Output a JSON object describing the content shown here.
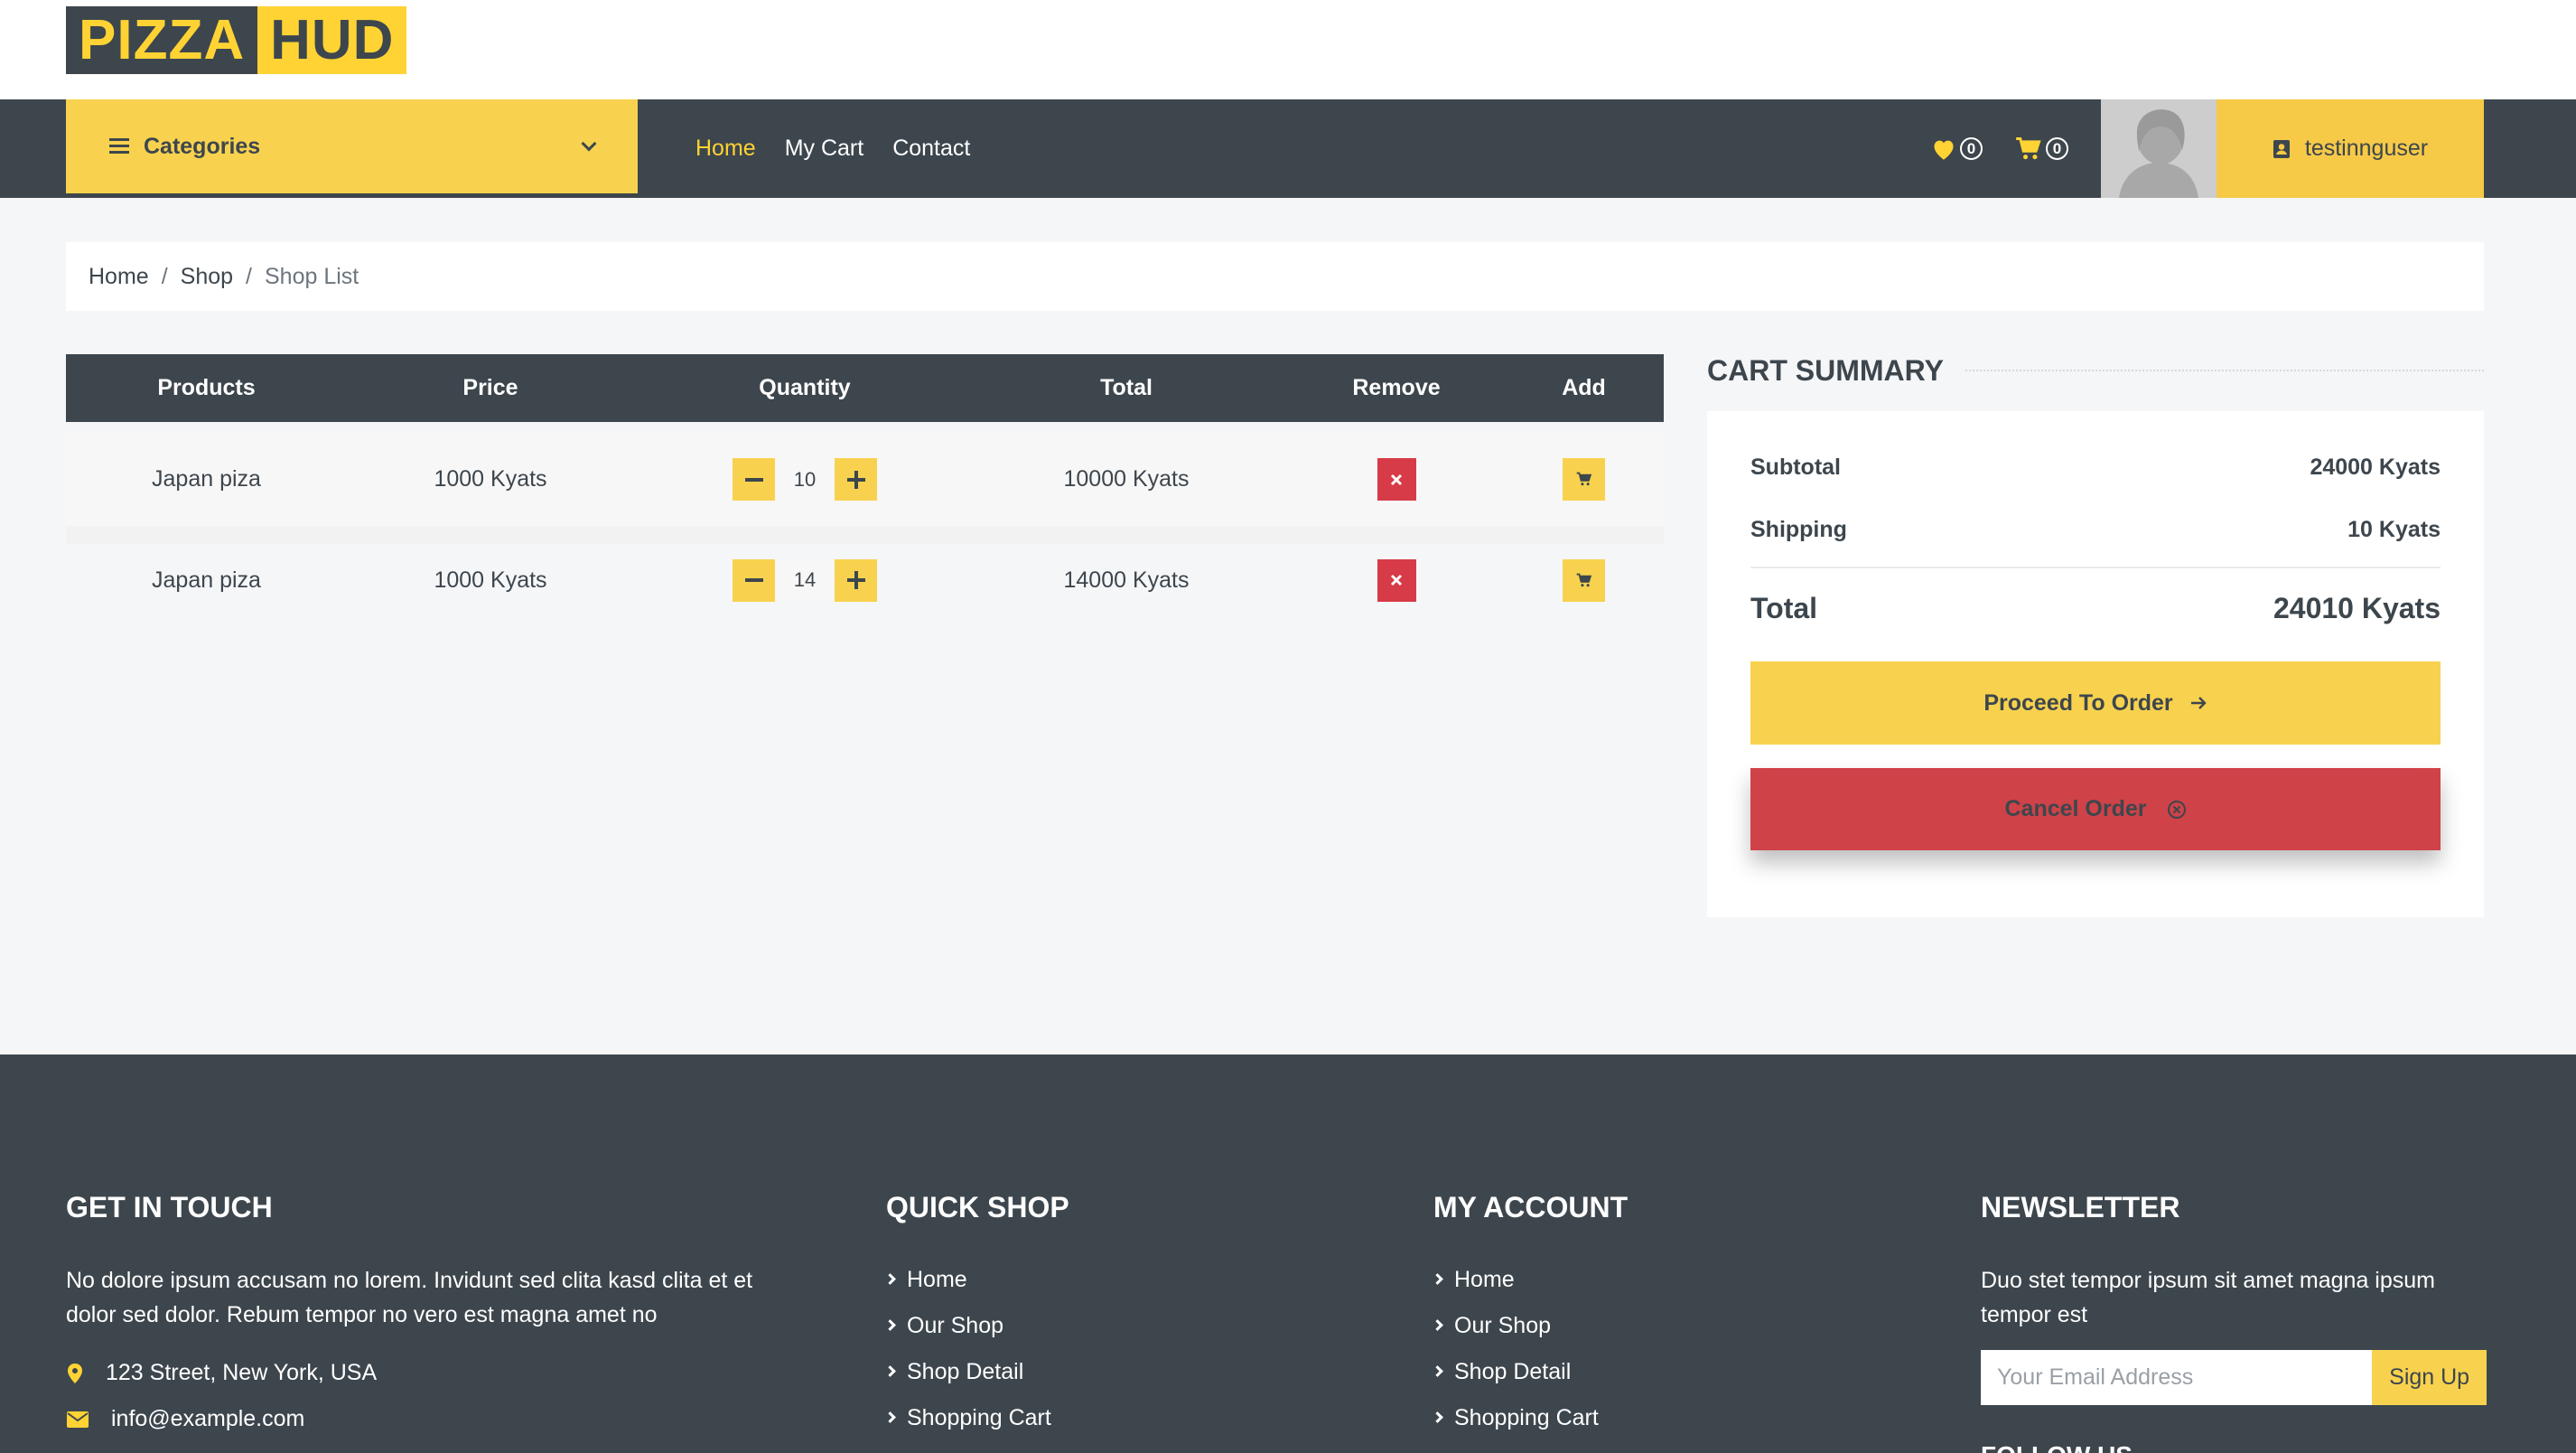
{
  "brand": {
    "part1": "PIZZA",
    "part2": "HUD"
  },
  "nav": {
    "categories_label": "Categories",
    "links": [
      {
        "label": "Home",
        "active": true
      },
      {
        "label": "My Cart",
        "active": false
      },
      {
        "label": "Contact",
        "active": false
      }
    ],
    "wishlist_count": "0",
    "cart_count": "0",
    "username": "testinnguser"
  },
  "breadcrumb": {
    "items": [
      "Home",
      "Shop",
      "Shop List"
    ],
    "separator": "/"
  },
  "cart": {
    "headers": [
      "Products",
      "Price",
      "Quantity",
      "Total",
      "Remove",
      "Add"
    ],
    "rows": [
      {
        "product": "Japan piza",
        "price": "1000 Kyats",
        "quantity": "10",
        "total": "10000 Kyats"
      },
      {
        "product": "Japan piza",
        "price": "1000 Kyats",
        "quantity": "14",
        "total": "14000 Kyats"
      }
    ]
  },
  "summary": {
    "title": "CART SUMMARY",
    "subtotal_label": "Subtotal",
    "subtotal_value": "24000 Kyats",
    "shipping_label": "Shipping",
    "shipping_value": "10 Kyats",
    "total_label": "Total",
    "total_value": "24010 Kyats",
    "proceed_label": "Proceed To Order",
    "cancel_label": "Cancel Order"
  },
  "footer": {
    "touch": {
      "title": "GET IN TOUCH",
      "text": "No dolore ipsum accusam no lorem. Invidunt sed clita kasd clita et et dolor sed dolor. Rebum tempor no vero est magna amet no",
      "address": "123 Street, New York, USA",
      "email": "info@example.com"
    },
    "quick_shop": {
      "title": "QUICK SHOP",
      "links": [
        "Home",
        "Our Shop",
        "Shop Detail",
        "Shopping Cart"
      ]
    },
    "my_account": {
      "title": "MY ACCOUNT",
      "links": [
        "Home",
        "Our Shop",
        "Shop Detail",
        "Shopping Cart"
      ]
    },
    "newsletter": {
      "title": "NEWSLETTER",
      "text": "Duo stet tempor ipsum sit amet magna ipsum tempor est",
      "placeholder": "Your Email Address",
      "button": "Sign Up",
      "follow": "FOLLOW US"
    }
  },
  "colors": {
    "accent": "#FFD333",
    "dark": "#3D464D",
    "danger": "#D63B47",
    "background": "#F5F6F8"
  }
}
